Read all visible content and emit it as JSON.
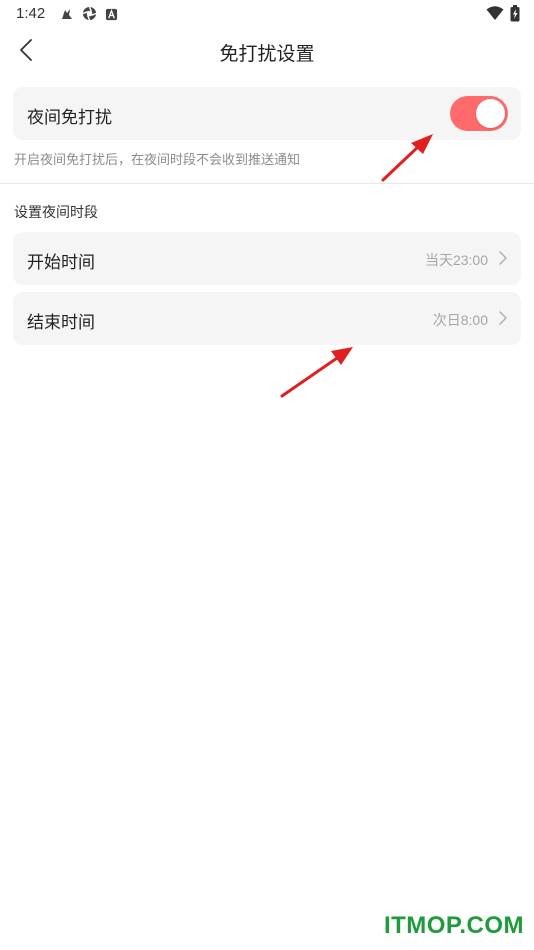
{
  "status_bar": {
    "time": "1:42",
    "left_icons": [
      "notification-bird-icon",
      "aperture-icon",
      "app-badge-icon"
    ],
    "right_icons": [
      "wifi-icon",
      "battery-charging-icon"
    ]
  },
  "header": {
    "title": "免打扰设置",
    "back_icon": "chevron-left-icon"
  },
  "night_dnd": {
    "label": "夜间免打扰",
    "enabled": true,
    "toggle_color": "#ff6b6b",
    "hint": "开启夜间免打扰后，在夜间时段不会收到推送通知"
  },
  "night_period": {
    "section_label": "设置夜间时段",
    "start": {
      "label": "开始时间",
      "value": "当天23:00"
    },
    "end": {
      "label": "结束时间",
      "value": "次日8:00"
    }
  },
  "annotations": {
    "arrow_color": "#e02020"
  },
  "watermark": "ITMOP.COM"
}
